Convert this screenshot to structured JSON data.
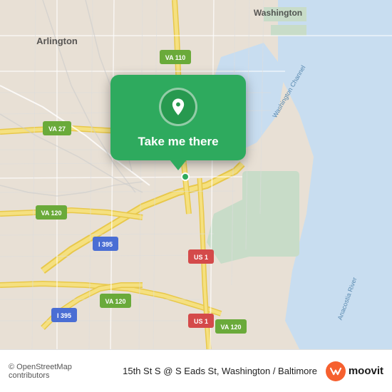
{
  "map": {
    "alt": "Map of Washington DC area showing Arlington and surrounding neighborhoods"
  },
  "popup": {
    "label": "Take me there",
    "icon": "location-pin-icon"
  },
  "bottom_bar": {
    "copyright": "© OpenStreetMap contributors",
    "address": "15th St S @ S Eads St, Washington / Baltimore",
    "logo_text": "moovit"
  }
}
